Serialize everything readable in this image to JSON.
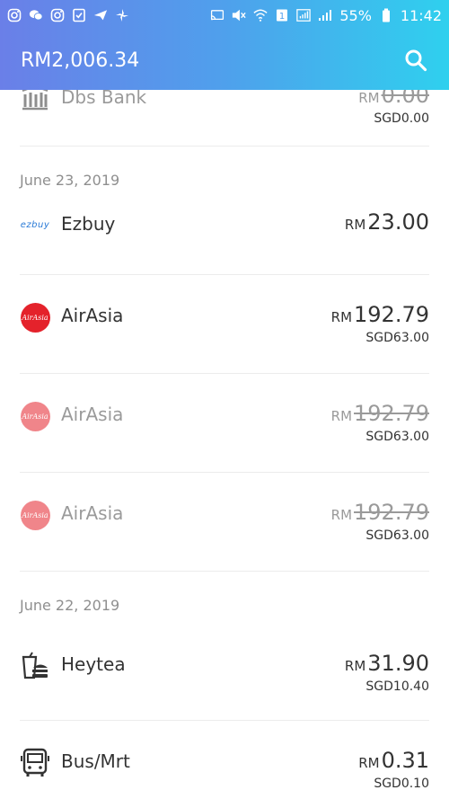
{
  "status_bar": {
    "battery": "55%",
    "time": "11:42"
  },
  "appbar": {
    "balance": "RM2,006.34"
  },
  "transactions": [
    {
      "name": "Dbs Bank",
      "cur": "RM",
      "amount": "0.00",
      "sub": "SGD0.00",
      "muted": true,
      "icon": "bank-icon"
    },
    {
      "date": "June 23, 2019"
    },
    {
      "name": "Ezbuy",
      "cur": "RM",
      "amount": "23.00",
      "sub": "",
      "muted": false,
      "icon": "ezbuy-logo",
      "logo_text": "ezbuy"
    },
    {
      "name": "AirAsia",
      "cur": "RM",
      "amount": "192.79",
      "sub": "SGD63.00",
      "muted": false,
      "icon": "airasia-logo",
      "logo_text": "AirAsia"
    },
    {
      "name": "AirAsia",
      "cur": "RM",
      "amount": "192.79",
      "sub": "SGD63.00",
      "muted": true,
      "icon": "airasia-logo",
      "logo_text": "AirAsia"
    },
    {
      "name": "AirAsia",
      "cur": "RM",
      "amount": "192.79",
      "sub": "SGD63.00",
      "muted": true,
      "icon": "airasia-logo",
      "logo_text": "AirAsia"
    },
    {
      "date": "June 22, 2019"
    },
    {
      "name": "Heytea",
      "cur": "RM",
      "amount": "31.90",
      "sub": "SGD10.40",
      "muted": false,
      "icon": "drink-food-icon"
    },
    {
      "name": "Bus/Mrt",
      "cur": "RM",
      "amount": "0.31",
      "sub": "SGD0.10",
      "muted": false,
      "icon": "bus-icon"
    }
  ]
}
